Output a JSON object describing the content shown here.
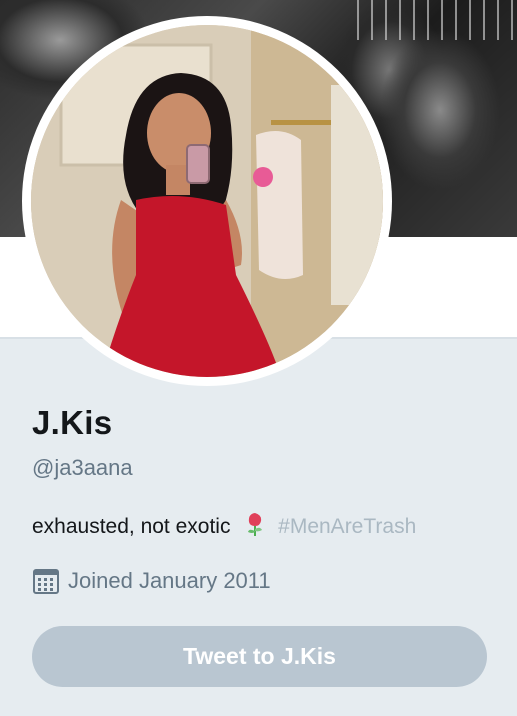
{
  "profile": {
    "display_name": "J.Kis",
    "handle": "@ja3aana",
    "bio_text": "exhausted, not exotic",
    "bio_emoji": "rose-emoji",
    "bio_hashtag": "#MenAreTrash",
    "joined_text": "Joined January 2011"
  },
  "actions": {
    "tweet_to_label": "Tweet to J.Kis"
  },
  "colors": {
    "page_bg": "#e6ecf0",
    "name_text": "#14171a",
    "secondary_text": "#657786",
    "hashtag_text": "#aab8c2",
    "button_bg": "#b9c6d1"
  },
  "icons": {
    "joined": "calendar-icon"
  }
}
